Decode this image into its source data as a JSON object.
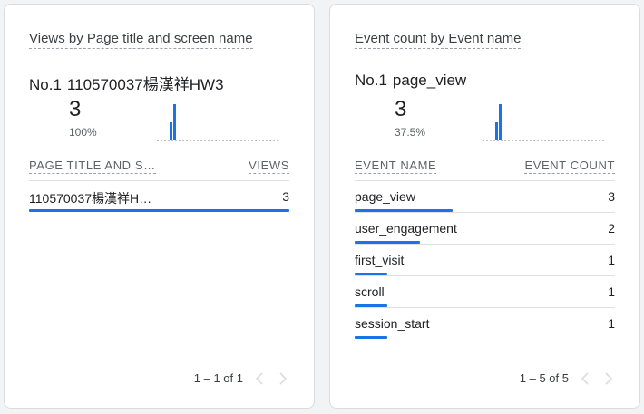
{
  "colors": {
    "accent": "#1a73e8",
    "divider": "#e0e0e0",
    "muted": "#5f6368"
  },
  "cards": [
    {
      "title": "Views by Page title and screen name",
      "top_rank": "No.1",
      "top_name": "110570037楊漢祥HW3",
      "top_value": "3",
      "top_share": "100%",
      "spark": [
        1,
        2
      ],
      "columns": {
        "label": "PAGE TITLE AND S…",
        "value": "VIEWS"
      },
      "rows": [
        {
          "label": "110570037楊漢祥H…",
          "value": "3",
          "fill": 1.0
        }
      ],
      "pager": {
        "range": "1 – 1 of 1",
        "prev_icon": "chevron-left-icon",
        "next_icon": "chevron-right-icon"
      }
    },
    {
      "title": "Event count by Event name",
      "top_rank": "No.1",
      "top_name": "page_view",
      "top_value": "3",
      "top_share": "37.5%",
      "spark": [
        1,
        2
      ],
      "columns": {
        "label": "EVENT NAME",
        "value": "EVENT COUNT"
      },
      "rows": [
        {
          "label": "page_view",
          "value": "3",
          "fill": 1.0
        },
        {
          "label": "user_engagement",
          "value": "2",
          "fill": 0.667
        },
        {
          "label": "first_visit",
          "value": "1",
          "fill": 0.333
        },
        {
          "label": "scroll",
          "value": "1",
          "fill": 0.333
        },
        {
          "label": "session_start",
          "value": "1",
          "fill": 0.333
        }
      ],
      "pager": {
        "range": "1 – 5 of 5",
        "prev_icon": "chevron-left-icon",
        "next_icon": "chevron-right-icon"
      }
    }
  ]
}
